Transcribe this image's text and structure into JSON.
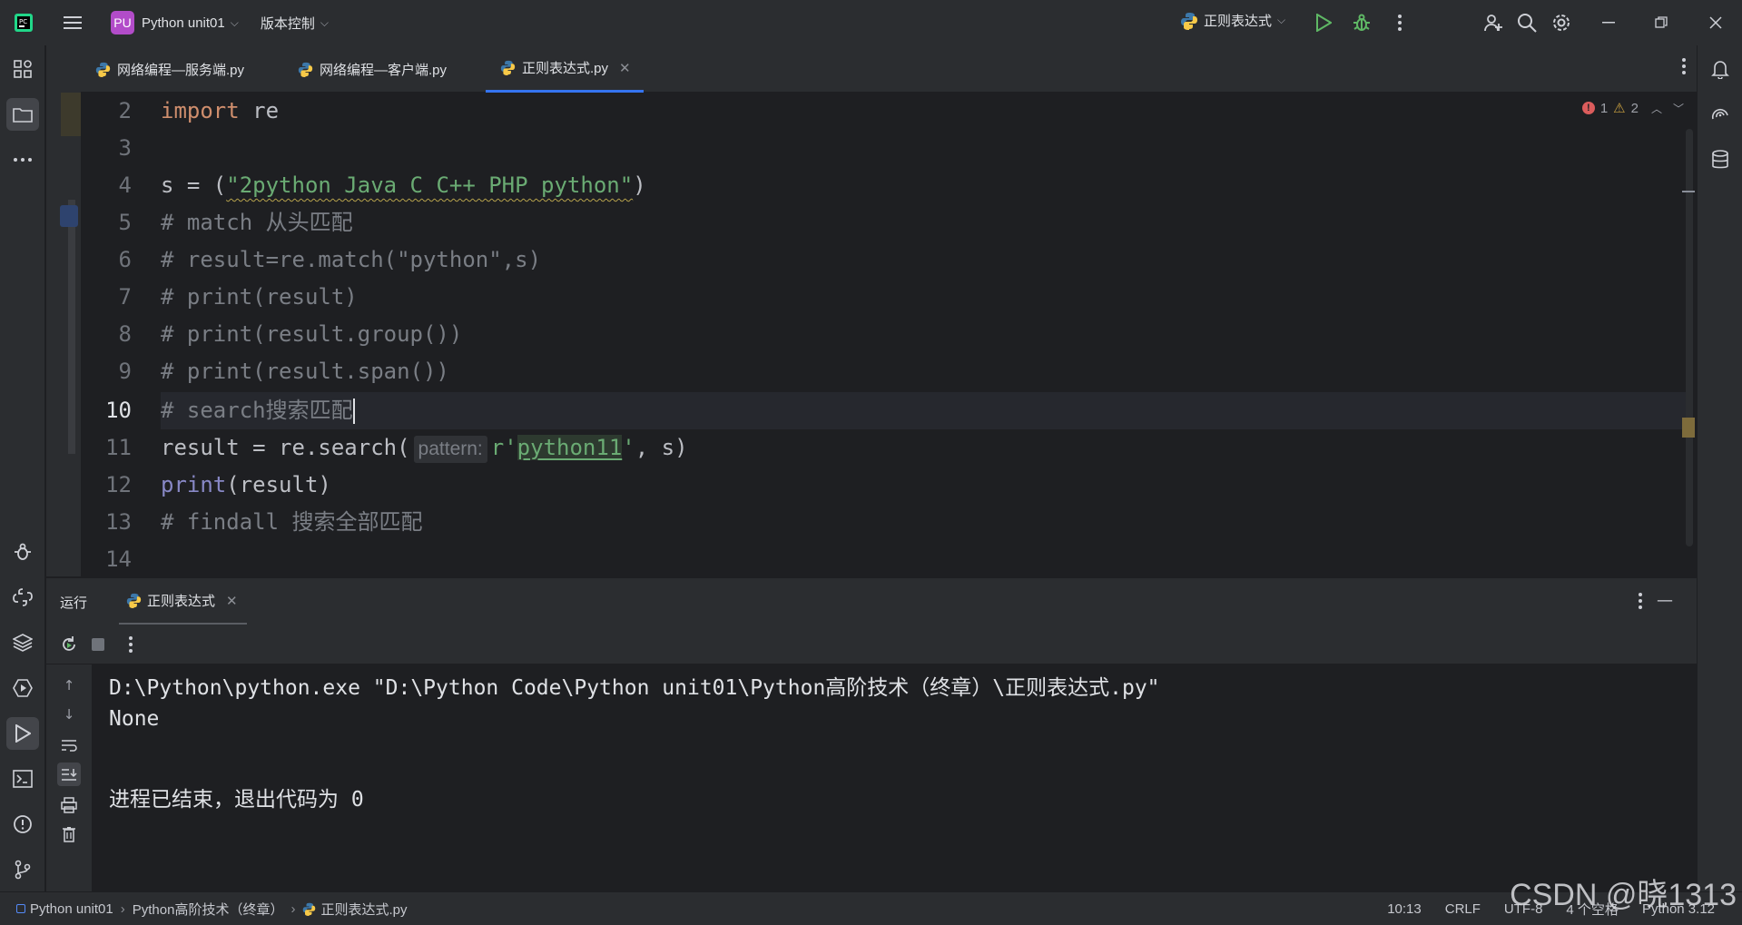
{
  "titlebar": {
    "project_badge": "PU",
    "project_name": "Python unit01",
    "vcs_label": "版本控制",
    "run_config": "正则表达式"
  },
  "tabs": [
    {
      "label": "网络编程—服务端.py",
      "active": false
    },
    {
      "label": "网络编程—客户端.py",
      "active": false
    },
    {
      "label": "正则表达式.py",
      "active": true
    }
  ],
  "editor": {
    "line_numbers": [
      "2",
      "3",
      "4",
      "5",
      "6",
      "7",
      "8",
      "9",
      "10",
      "11",
      "12",
      "13",
      "14"
    ],
    "current_line": "10",
    "inspections": {
      "errors": "1",
      "warnings": "2"
    },
    "code": {
      "l2_kw": "import",
      "l2_rest": " re",
      "l4_pre": "s = (",
      "l4_str": "\"2python Java C C++ PHP python\"",
      "l4_post": ")",
      "l5": "# match 从头匹配",
      "l6": "# result=re.match(\"python\",s)",
      "l7": "# print(result)",
      "l8": "# print(result.group())",
      "l9": "# print(result.span())",
      "l10": "# search搜索匹配",
      "l11_pre": "result = re.search(",
      "l11_hint": "pattern:",
      "l11_str_a": "r'",
      "l11_str_b": "python11",
      "l11_str_c": "'",
      "l11_post": ", s)",
      "l12_fn": "print",
      "l12_rest": "(result)",
      "l13": "# findall 搜索全部匹配"
    }
  },
  "run_panel": {
    "title": "运行",
    "tab_label": "正则表达式",
    "console": [
      "D:\\Python\\python.exe \"D:\\Python Code\\Python unit01\\Python高阶技术（终章）\\正则表达式.py\"",
      "None",
      "",
      "进程已结束，退出代码为 0"
    ]
  },
  "statusbar": {
    "breadcrumb": [
      "Python unit01",
      "Python高阶技术（终章）",
      "正则表达式.py"
    ],
    "position": "10:13",
    "line_sep": "CRLF",
    "encoding": "UTF-8",
    "indent": "4 个空格",
    "interpreter": "Python 3.12"
  },
  "watermark": "CSDN @晓1313",
  "colors": {
    "accent": "#3574f0",
    "keyword": "#cf8e6d",
    "string": "#6aab73",
    "comment": "#7a7e85",
    "run_green": "#5fb865"
  },
  "icons": [
    "app-logo-icon",
    "hamburger-menu-icon",
    "python-icon",
    "run-icon",
    "debug-icon",
    "more-icon",
    "add-user-icon",
    "search-icon",
    "gear-icon",
    "minimize-icon",
    "restore-icon",
    "close-icon",
    "structure-icon",
    "folder-icon",
    "bell-icon",
    "ai-assistant-icon",
    "database-icon",
    "rerun-icon",
    "stop-icon",
    "trash-icon",
    "print-icon",
    "wrap-icon",
    "scroll-end-icon",
    "terminal-icon",
    "problems-icon",
    "git-icon",
    "layers-icon",
    "services-icon",
    "bug-icon"
  ]
}
